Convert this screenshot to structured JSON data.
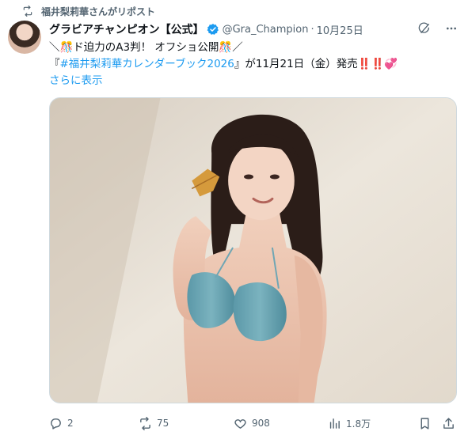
{
  "repost": {
    "text": "福井梨莉華さんがリポスト",
    "icon": "repost-icon"
  },
  "author": {
    "display_name": "グラビアチャンピオン【公式】",
    "handle": "@Gra_Champion",
    "separator": "·",
    "date": "10月25日",
    "verified_color": "#1d9bf0"
  },
  "tweet": {
    "line1": "＼🎊ド迫力のA3判！ オフショ公開🎊／",
    "line2_prefix": "『",
    "hashtag": "#福井梨莉華カレンダーブック2026",
    "line2_suffix": "』が11月21日（金）発売‼️‼️💞",
    "show_more": "さらに表示"
  },
  "actions": {
    "reply_count": "2",
    "repost_count": "75",
    "like_count": "908",
    "views_count": "1.8万"
  },
  "colors": {
    "accent": "#1d9bf0",
    "muted": "#536471",
    "text": "#0f1419"
  }
}
